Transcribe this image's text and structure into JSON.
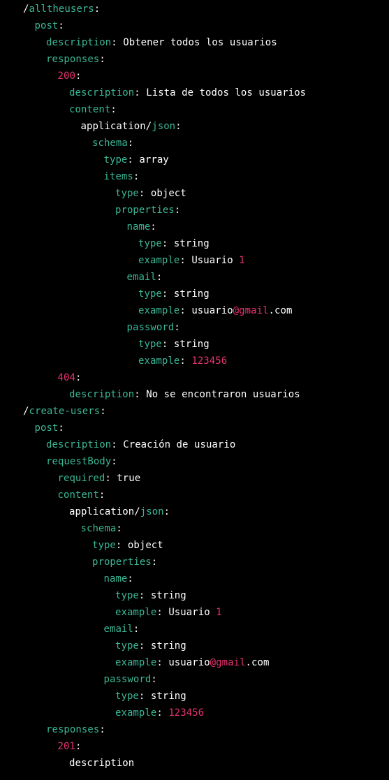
{
  "colors": {
    "background": "#000000",
    "key": "#3ab795",
    "number": "#e8336f",
    "text": "#ffffff"
  },
  "lines": [
    {
      "indent": 2,
      "tokens": [
        {
          "t": "/",
          "k": "text"
        },
        {
          "t": "alltheusers",
          "k": "key"
        },
        {
          "t": ":",
          "k": "text"
        }
      ]
    },
    {
      "indent": 3,
      "tokens": [
        {
          "t": "post",
          "k": "key"
        },
        {
          "t": ":",
          "k": "text"
        }
      ]
    },
    {
      "indent": 4,
      "tokens": [
        {
          "t": "description",
          "k": "key"
        },
        {
          "t": ": Obtener todos los usuarios",
          "k": "text"
        }
      ]
    },
    {
      "indent": 4,
      "tokens": [
        {
          "t": "responses",
          "k": "key"
        },
        {
          "t": ":",
          "k": "text"
        }
      ]
    },
    {
      "indent": 5,
      "tokens": [
        {
          "t": "200",
          "k": "num"
        },
        {
          "t": ":",
          "k": "text"
        }
      ]
    },
    {
      "indent": 6,
      "tokens": [
        {
          "t": "description",
          "k": "key"
        },
        {
          "t": ": Lista de todos los usuarios",
          "k": "text"
        }
      ]
    },
    {
      "indent": 6,
      "tokens": [
        {
          "t": "content",
          "k": "key"
        },
        {
          "t": ":",
          "k": "text"
        }
      ]
    },
    {
      "indent": 7,
      "tokens": [
        {
          "t": "application/",
          "k": "text"
        },
        {
          "t": "json",
          "k": "key"
        },
        {
          "t": ":",
          "k": "text"
        }
      ]
    },
    {
      "indent": 8,
      "tokens": [
        {
          "t": "schema",
          "k": "key"
        },
        {
          "t": ":",
          "k": "text"
        }
      ]
    },
    {
      "indent": 9,
      "tokens": [
        {
          "t": "type",
          "k": "key"
        },
        {
          "t": ": array",
          "k": "text"
        }
      ]
    },
    {
      "indent": 9,
      "tokens": [
        {
          "t": "items",
          "k": "key"
        },
        {
          "t": ":",
          "k": "text"
        }
      ]
    },
    {
      "indent": 10,
      "tokens": [
        {
          "t": "type",
          "k": "key"
        },
        {
          "t": ": object",
          "k": "text"
        }
      ]
    },
    {
      "indent": 10,
      "tokens": [
        {
          "t": "properties",
          "k": "key"
        },
        {
          "t": ":",
          "k": "text"
        }
      ]
    },
    {
      "indent": 11,
      "tokens": [
        {
          "t": "name",
          "k": "key"
        },
        {
          "t": ":",
          "k": "text"
        }
      ]
    },
    {
      "indent": 12,
      "tokens": [
        {
          "t": "type",
          "k": "key"
        },
        {
          "t": ": string",
          "k": "text"
        }
      ]
    },
    {
      "indent": 12,
      "tokens": [
        {
          "t": "example",
          "k": "key"
        },
        {
          "t": ": Usuario ",
          "k": "text"
        },
        {
          "t": "1",
          "k": "num"
        }
      ]
    },
    {
      "indent": 11,
      "tokens": [
        {
          "t": "email",
          "k": "key"
        },
        {
          "t": ":",
          "k": "text"
        }
      ]
    },
    {
      "indent": 12,
      "tokens": [
        {
          "t": "type",
          "k": "key"
        },
        {
          "t": ": string",
          "k": "text"
        }
      ]
    },
    {
      "indent": 12,
      "tokens": [
        {
          "t": "example",
          "k": "key"
        },
        {
          "t": ": usuario",
          "k": "text"
        },
        {
          "t": "@gmail",
          "k": "num"
        },
        {
          "t": ".com",
          "k": "text"
        }
      ]
    },
    {
      "indent": 11,
      "tokens": [
        {
          "t": "password",
          "k": "key"
        },
        {
          "t": ":",
          "k": "text"
        }
      ]
    },
    {
      "indent": 12,
      "tokens": [
        {
          "t": "type",
          "k": "key"
        },
        {
          "t": ": string",
          "k": "text"
        }
      ]
    },
    {
      "indent": 12,
      "tokens": [
        {
          "t": "example",
          "k": "key"
        },
        {
          "t": ": ",
          "k": "text"
        },
        {
          "t": "123456",
          "k": "num"
        }
      ]
    },
    {
      "indent": 5,
      "tokens": [
        {
          "t": "404",
          "k": "num"
        },
        {
          "t": ":",
          "k": "text"
        }
      ]
    },
    {
      "indent": 6,
      "tokens": [
        {
          "t": "description",
          "k": "key"
        },
        {
          "t": ": No se encontraron usuarios",
          "k": "text"
        }
      ]
    },
    {
      "indent": 2,
      "tokens": [
        {
          "t": "/",
          "k": "text"
        },
        {
          "t": "create-users",
          "k": "key"
        },
        {
          "t": ":",
          "k": "text"
        }
      ]
    },
    {
      "indent": 3,
      "tokens": [
        {
          "t": "post",
          "k": "key"
        },
        {
          "t": ":",
          "k": "text"
        }
      ]
    },
    {
      "indent": 4,
      "tokens": [
        {
          "t": "description",
          "k": "key"
        },
        {
          "t": ": Creación de usuario",
          "k": "text"
        }
      ]
    },
    {
      "indent": 4,
      "tokens": [
        {
          "t": "requestBody",
          "k": "key"
        },
        {
          "t": ":",
          "k": "text"
        }
      ]
    },
    {
      "indent": 5,
      "tokens": [
        {
          "t": "required",
          "k": "key"
        },
        {
          "t": ": true",
          "k": "text"
        }
      ]
    },
    {
      "indent": 5,
      "tokens": [
        {
          "t": "content",
          "k": "key"
        },
        {
          "t": ":",
          "k": "text"
        }
      ]
    },
    {
      "indent": 6,
      "tokens": [
        {
          "t": "application/",
          "k": "text"
        },
        {
          "t": "json",
          "k": "key"
        },
        {
          "t": ":",
          "k": "text"
        }
      ]
    },
    {
      "indent": 7,
      "tokens": [
        {
          "t": "schema",
          "k": "key"
        },
        {
          "t": ":",
          "k": "text"
        }
      ]
    },
    {
      "indent": 8,
      "tokens": [
        {
          "t": "type",
          "k": "key"
        },
        {
          "t": ": object",
          "k": "text"
        }
      ]
    },
    {
      "indent": 8,
      "tokens": [
        {
          "t": "properties",
          "k": "key"
        },
        {
          "t": ":",
          "k": "text"
        }
      ]
    },
    {
      "indent": 9,
      "tokens": [
        {
          "t": "name",
          "k": "key"
        },
        {
          "t": ":",
          "k": "text"
        }
      ]
    },
    {
      "indent": 10,
      "tokens": [
        {
          "t": "type",
          "k": "key"
        },
        {
          "t": ": string",
          "k": "text"
        }
      ]
    },
    {
      "indent": 10,
      "tokens": [
        {
          "t": "example",
          "k": "key"
        },
        {
          "t": ": Usuario ",
          "k": "text"
        },
        {
          "t": "1",
          "k": "num"
        }
      ]
    },
    {
      "indent": 9,
      "tokens": [
        {
          "t": "email",
          "k": "key"
        },
        {
          "t": ":",
          "k": "text"
        }
      ]
    },
    {
      "indent": 10,
      "tokens": [
        {
          "t": "type",
          "k": "key"
        },
        {
          "t": ": string",
          "k": "text"
        }
      ]
    },
    {
      "indent": 10,
      "tokens": [
        {
          "t": "example",
          "k": "key"
        },
        {
          "t": ": usuario",
          "k": "text"
        },
        {
          "t": "@gmail",
          "k": "num"
        },
        {
          "t": ".com",
          "k": "text"
        }
      ]
    },
    {
      "indent": 9,
      "tokens": [
        {
          "t": "password",
          "k": "key"
        },
        {
          "t": ":",
          "k": "text"
        }
      ]
    },
    {
      "indent": 10,
      "tokens": [
        {
          "t": "type",
          "k": "key"
        },
        {
          "t": ": string",
          "k": "text"
        }
      ]
    },
    {
      "indent": 10,
      "tokens": [
        {
          "t": "example",
          "k": "key"
        },
        {
          "t": ": ",
          "k": "text"
        },
        {
          "t": "123456",
          "k": "num"
        }
      ]
    },
    {
      "indent": 4,
      "tokens": [
        {
          "t": "responses",
          "k": "key"
        },
        {
          "t": ":",
          "k": "text"
        }
      ]
    },
    {
      "indent": 5,
      "tokens": [
        {
          "t": "201",
          "k": "num"
        },
        {
          "t": ":",
          "k": "text"
        }
      ]
    },
    {
      "indent": 6,
      "tokens": [
        {
          "t": "description",
          "k": "text"
        }
      ]
    }
  ]
}
